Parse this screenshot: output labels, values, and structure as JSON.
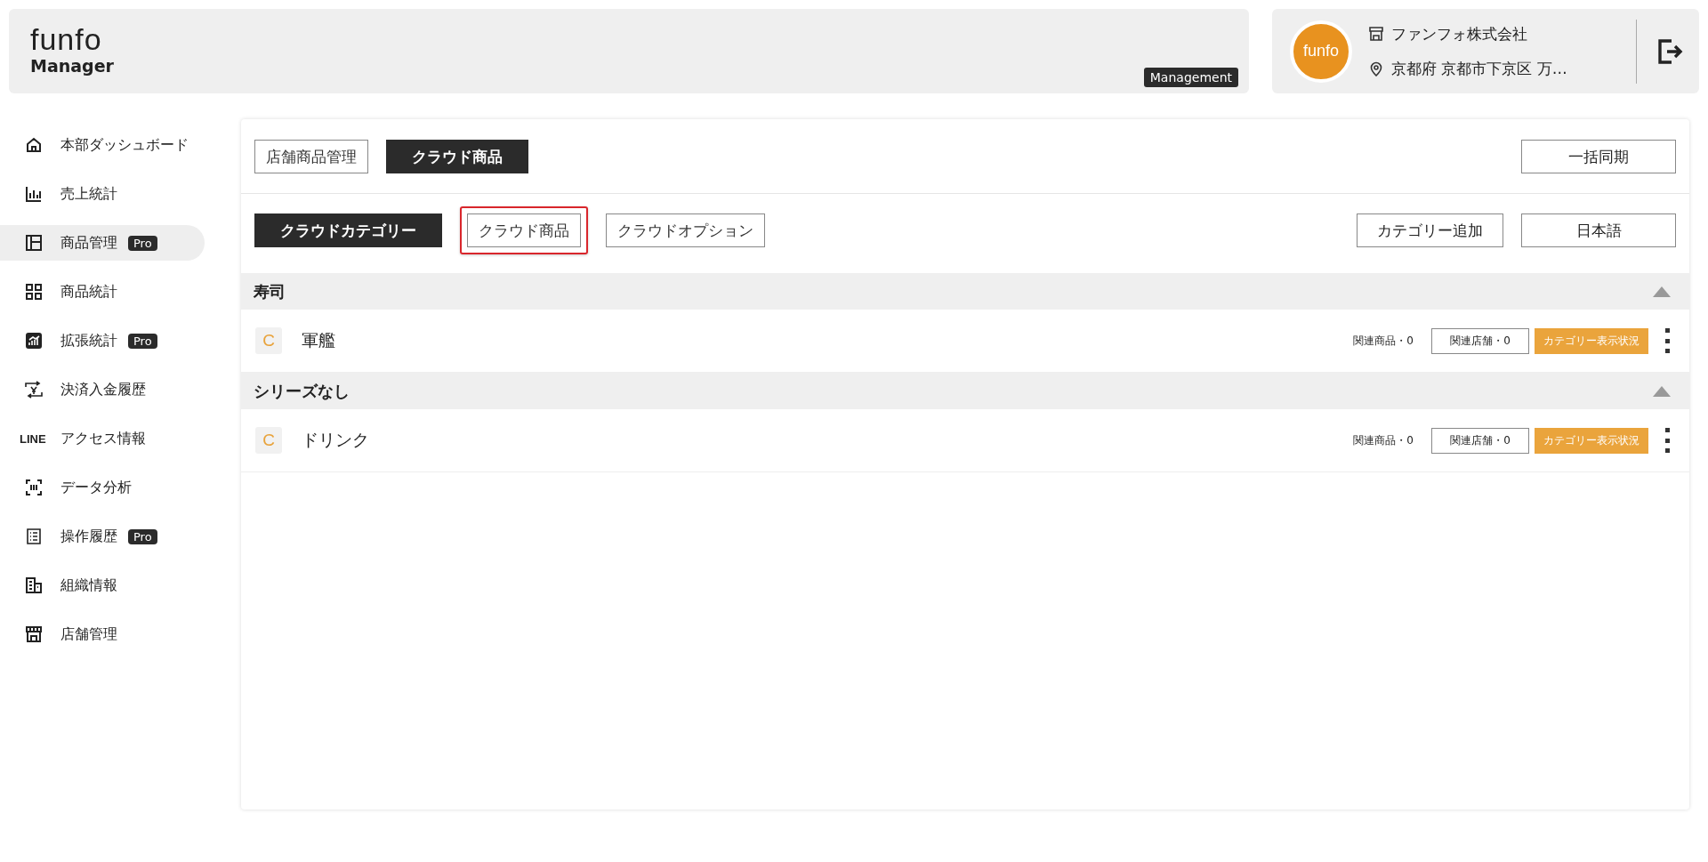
{
  "header": {
    "logo": "funfo",
    "logo_sub": "Manager",
    "mode_badge": "Management",
    "avatar_text": "funfo",
    "company": "ファンフォ株式会社",
    "address": "京都府 京都市下京区 万…"
  },
  "sidebar": {
    "items": [
      {
        "label": "本部ダッシュボード",
        "selected": false
      },
      {
        "label": "売上統計",
        "selected": false
      },
      {
        "label": "商品管理",
        "pro_badge": "Pro",
        "selected": true
      },
      {
        "label": "商品統計",
        "selected": false
      },
      {
        "label": "拡張統計",
        "pro_badge": "Pro",
        "selected": false
      },
      {
        "label": "決済入金履歴",
        "selected": false
      },
      {
        "label": "アクセス情報",
        "icon_text": "LINE",
        "selected": false
      },
      {
        "label": "データ分析",
        "selected": false
      },
      {
        "label": "操作履歴",
        "pro_badge": "Pro",
        "selected": false
      },
      {
        "label": "組織情報",
        "selected": false
      },
      {
        "label": "店舗管理",
        "selected": false
      }
    ]
  },
  "tabs": [
    {
      "label": "店舗商品管理",
      "selected": false
    },
    {
      "label": "クラウド商品",
      "selected": true
    }
  ],
  "sync_button": "一括同期",
  "subtabs": [
    {
      "label": "クラウドカテゴリー",
      "selected": true,
      "highlighted": false
    },
    {
      "label": "クラウド商品",
      "selected": false,
      "highlighted": true
    },
    {
      "label": "クラウドオプション",
      "selected": false,
      "highlighted": false
    }
  ],
  "add_category_button": "カテゴリー追加",
  "language_button": "日本語",
  "groups": [
    {
      "name": "寿司",
      "expanded": true,
      "rows": [
        {
          "badge": "C",
          "name": "軍艦",
          "related_products": "関連商品・0",
          "related_stores": "関連店舗・0",
          "visibility": "カテゴリー表示状況"
        }
      ]
    },
    {
      "name": "シリーズなし",
      "expanded": true,
      "rows": [
        {
          "badge": "C",
          "name": "ドリンク",
          "related_products": "関連商品・0",
          "related_stores": "関連店舗・0",
          "visibility": "カテゴリー表示状況"
        }
      ]
    }
  ]
}
